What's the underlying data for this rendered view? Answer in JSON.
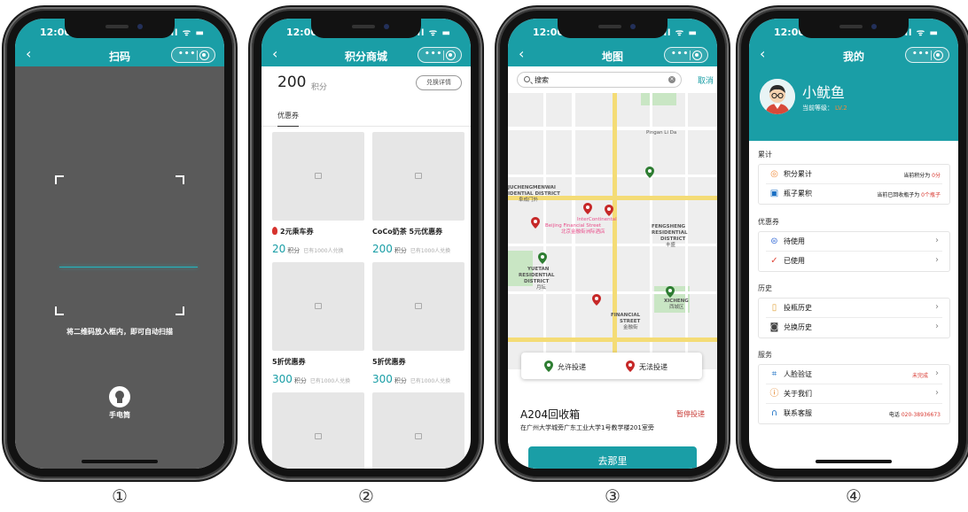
{
  "colors": {
    "teal": "#1a9ea6",
    "red": "#d8372f",
    "orange": "#f08c3c",
    "green_pin": "#2e7d32"
  },
  "statusbar": {
    "time": "12:00",
    "signal": "ıl ᯤ ▬"
  },
  "capsule": {
    "dots": "•••"
  },
  "captions": [
    "①",
    "②",
    "③",
    "④"
  ],
  "scan": {
    "title": "扫码",
    "hint": "将二维码放入框内，即可自动扫描",
    "torch": "手电筒"
  },
  "shop": {
    "title": "积分商城",
    "points": "200",
    "points_unit": "积分",
    "redeem_btn": "兑换详情",
    "tab": "优惠券",
    "items": [
      {
        "name": "2元乘车券",
        "price": "20",
        "unit": "积分",
        "count": "已有1000人兑换"
      },
      {
        "name": "CoCo奶茶 5元优惠券",
        "price": "200",
        "unit": "积分",
        "count": "已有1000人兑换"
      },
      {
        "name": "5折优惠券",
        "price": "300",
        "unit": "积分",
        "count": "已有1000人兑换"
      },
      {
        "name": "5折优惠券",
        "price": "300",
        "unit": "积分",
        "count": "已有1000人兑换"
      }
    ]
  },
  "map": {
    "title": "地图",
    "search_text": "搜索",
    "clear": "×",
    "cancel": "取消",
    "labels": {
      "huayuan": "Pingan Li Da",
      "jincheng1": "JUCHENGMENWAI",
      "jincheng2": "IDENTIAL DISTRICT",
      "jincheng3": "阜成门外",
      "ic1": "InterContinental",
      "ic2": "Beijing Financial Street",
      "ic3": "北京金融街洲际酒店",
      "feng1": "FENGSHENG",
      "feng2": "RESIDENTIAL",
      "feng3": "DISTRICT",
      "feng4": "丰盛",
      "yuetan1": "YUETAN",
      "yuetan2": "RESIDENTIAL",
      "yuetan3": "DISTRICT",
      "yuetan4": "月坛",
      "fin1": "FINANCIAL",
      "fin2": "STREET",
      "fin3": "金融街",
      "xicheng1": "XICHENG",
      "xicheng2": "西城区"
    },
    "legend": {
      "allow": "允许投递",
      "deny": "无法投递"
    },
    "station": {
      "name": "A204回收箱",
      "status": "暂停投递",
      "address": "在广州大学城旁广东工业大学1号教学楼201室旁"
    },
    "go_btn": "去那里"
  },
  "mine": {
    "title": "我的",
    "username": "小鱿鱼",
    "level_label": "当前等级：",
    "level_value": "LV.2",
    "sections": {
      "accumulate": "累计",
      "coupon": "优惠券",
      "history": "历史",
      "service": "服务"
    },
    "rows": {
      "points_total": {
        "label": "积分累计",
        "right_prefix": "当前积分为 ",
        "right_value": "0分"
      },
      "bottle_total": {
        "label": "瓶子累积",
        "right_prefix": "当前已回收瓶子为 ",
        "right_value": "0个瓶子"
      },
      "pending": {
        "label": "待使用"
      },
      "used": {
        "label": "已使用"
      },
      "deposit_history": {
        "label": "投瓶历史"
      },
      "redeem_history": {
        "label": "兑换历史"
      },
      "face_verify": {
        "label": "人脸验证",
        "right": "未完成"
      },
      "about": {
        "label": "关于我们"
      },
      "support": {
        "label": "联系客服",
        "right_prefix": "电话 ",
        "right_value": "020-38936673"
      }
    },
    "chevron": "›"
  }
}
